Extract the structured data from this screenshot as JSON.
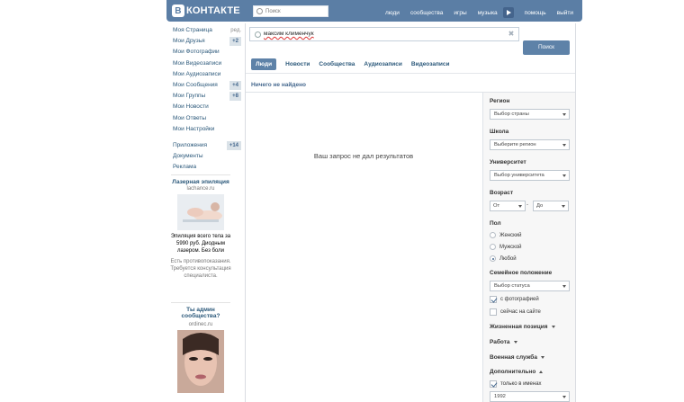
{
  "header": {
    "logo_mark": "В",
    "logo_text": "КОНТАКТЕ",
    "search_placeholder": "Поиск",
    "nav": [
      "люди",
      "сообщества",
      "игры",
      "музыка",
      "помощь",
      "выйти"
    ]
  },
  "sidebar": {
    "items": [
      {
        "label": "Моя Страница",
        "extra": "ред."
      },
      {
        "label": "Мои Друзья",
        "badge": "+2"
      },
      {
        "label": "Мои Фотографии"
      },
      {
        "label": "Мои Видеозаписи"
      },
      {
        "label": "Мои Аудиозаписи"
      },
      {
        "label": "Мои Сообщения",
        "badge": "+4"
      },
      {
        "label": "Мои Группы",
        "badge": "+8"
      },
      {
        "label": "Мои Новости"
      },
      {
        "label": "Мои Ответы"
      },
      {
        "label": "Мои Настройки"
      }
    ],
    "extra_items": [
      {
        "label": "Приложения",
        "badge": "+14"
      },
      {
        "label": "Документы"
      },
      {
        "label": "Реклама"
      }
    ]
  },
  "ads": [
    {
      "title": "Лазерная эпиляция",
      "domain": "lachance.ru",
      "text": "Эпиляция всего тела за 5990 руб. Диодным лазером. Без боли",
      "note": "Есть противопоказания. Требуется консультация специалиста."
    },
    {
      "title": "Ты админ сообщества?",
      "domain": "ordinec.ru"
    }
  ],
  "search": {
    "query": "максим клименчук",
    "button": "Поиск"
  },
  "tabs": [
    "Люди",
    "Новости",
    "Сообщества",
    "Аудиозаписи",
    "Видеозаписи"
  ],
  "active_tab": "Люди",
  "results": {
    "status": "Ничего не найдено",
    "empty_message": "Ваш запрос не дал результатов"
  },
  "filters": {
    "region_label": "Регион",
    "region_value": "Выбор страны",
    "school_label": "Школа",
    "school_value": "Выберите регион",
    "university_label": "Университет",
    "university_value": "Выбор университета",
    "age_label": "Возраст",
    "age_from": "От",
    "age_dash": "-",
    "age_to": "До",
    "gender_label": "Пол",
    "gender_options": [
      "Женский",
      "Мужской",
      "Любой"
    ],
    "gender_selected": "Любой",
    "status_label": "Семейное положение",
    "status_value": "Выбор статуса",
    "with_photo": "с фотографией",
    "with_photo_checked": true,
    "online_now": "сейчас на сайте",
    "online_now_checked": false,
    "life_position": "Жизненная позиция",
    "work": "Работа",
    "military": "Военная служба",
    "additional": "Дополнительно",
    "names_only": "только в именах",
    "names_only_checked": true,
    "birth_year": "1992"
  }
}
